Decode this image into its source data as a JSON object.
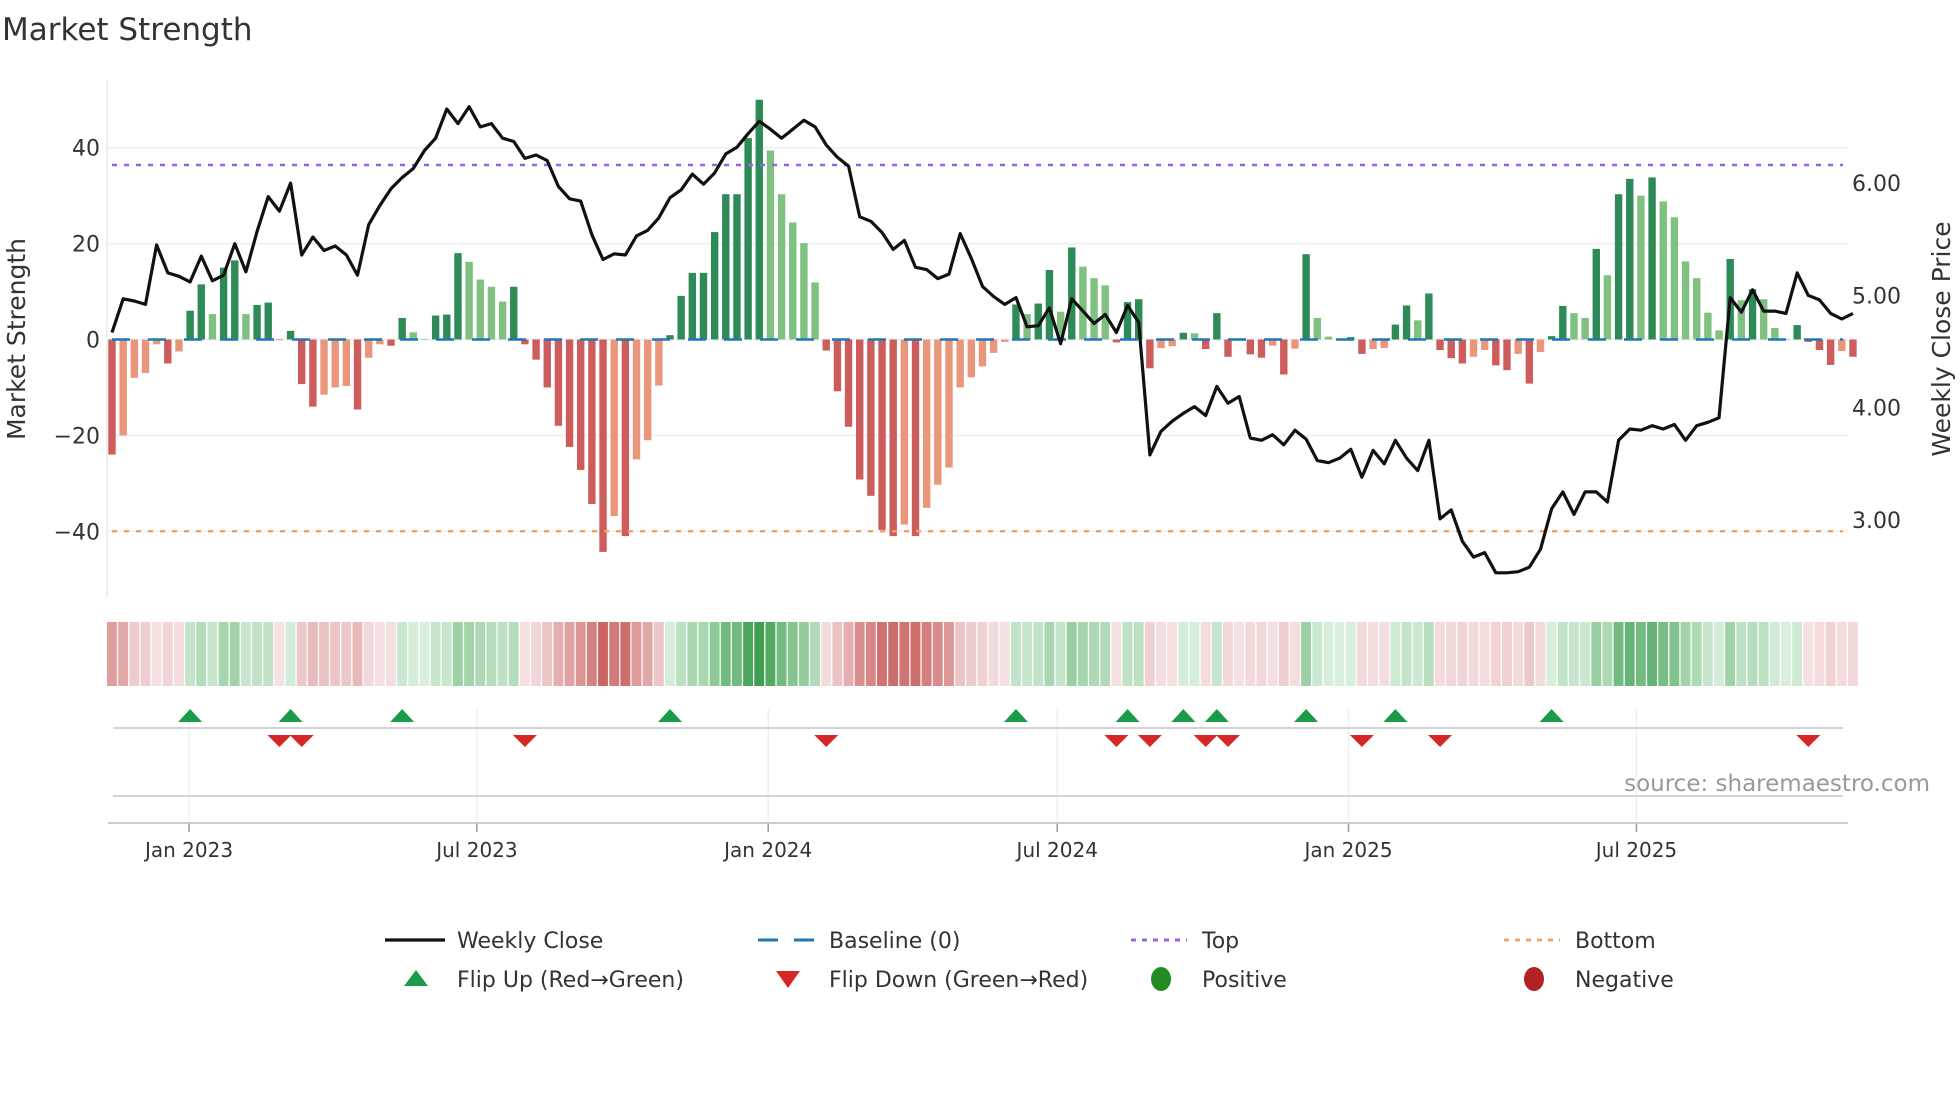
{
  "title": "Market Strength",
  "source": "source: sharemaestro.com",
  "colors": {
    "bar_up_strong": "#2e8b57",
    "bar_up_weak": "#80c080",
    "bar_down_strong": "#cd5c5c",
    "bar_down_weak": "#e9967a",
    "close_line": "#111111",
    "baseline": "#1f77b4",
    "top": "#9b63e0",
    "bottom": "#f4a460",
    "flip_up": "#1a9c46",
    "flip_down": "#d62728",
    "positive": "#228b22",
    "negative": "#b22222"
  },
  "chart_data": {
    "type": "bar",
    "title": "Market Strength",
    "x_unit": "week index (weekly observations)",
    "strength": [
      -24,
      -20,
      -8,
      -7,
      -1,
      -5,
      -2.5,
      6,
      11.5,
      5.3,
      15,
      16.5,
      5.3,
      7.2,
      7.7,
      -0.1,
      1.8,
      -9.3,
      -14,
      -11.5,
      -10,
      -9.7,
      -14.6,
      -3.8,
      -1,
      -1.3,
      4.5,
      1.5,
      0.1,
      5,
      5.2,
      18,
      16.2,
      12.5,
      11,
      7.9,
      11,
      -1,
      -4.2,
      -10,
      -18,
      -22.4,
      -27.2,
      -34.3,
      -44.3,
      -36.8,
      -41,
      -25,
      -21,
      -9.6,
      0.9,
      9.1,
      13.9,
      13.9,
      22.4,
      30.3,
      30.3,
      42,
      50,
      39.4,
      30.3,
      24.4,
      20.1,
      11.9,
      -2.3,
      -10.8,
      -18.2,
      -29.2,
      -32.6,
      -39.7,
      -41,
      -38.6,
      -41,
      -35.1,
      -30.3,
      -26.7,
      -10,
      -7.9,
      -5.6,
      -2.8,
      -0.5,
      7.3,
      5.3,
      7.5,
      14.5,
      5.8,
      19.2,
      15.2,
      12.8,
      11.3,
      -0.6,
      7.8,
      8.4,
      -6,
      -1.8,
      -1.4,
      1.4,
      1.3,
      -2,
      5.5,
      -3.6,
      -0.2,
      -3.1,
      -3.8,
      -1.3,
      -7.3,
      -1.9,
      17.8,
      4.5,
      0.6,
      0.2,
      0.5,
      -3,
      -2,
      -1.8,
      3.1,
      7.1,
      4,
      9.6,
      -2.2,
      -3.9,
      -5,
      -3.6,
      -2.2,
      -5.4,
      -6.4,
      -3,
      -9.2,
      -2.6,
      0.7,
      7,
      5.5,
      4.5,
      18.9,
      13.4,
      30.3,
      33.5,
      30,
      33.8,
      28.8,
      25.5,
      16.3,
      12.8,
      5.6,
      1.9,
      16.8,
      8.2,
      10.5,
      8.4,
      2.4,
      0.1,
      3,
      -0.5,
      -2.2,
      -5.3,
      -2.4,
      -3.6
    ],
    "weekly_close": [
      4.67,
      4.97,
      4.95,
      4.92,
      5.45,
      5.2,
      5.17,
      5.12,
      5.35,
      5.13,
      5.18,
      5.46,
      5.21,
      5.57,
      5.88,
      5.75,
      6.0,
      5.36,
      5.52,
      5.4,
      5.44,
      5.36,
      5.18,
      5.63,
      5.8,
      5.95,
      6.05,
      6.13,
      6.29,
      6.4,
      6.66,
      6.53,
      6.68,
      6.5,
      6.53,
      6.4,
      6.37,
      6.22,
      6.25,
      6.2,
      5.97,
      5.86,
      5.84,
      5.54,
      5.32,
      5.37,
      5.36,
      5.53,
      5.58,
      5.69,
      5.87,
      5.94,
      6.08,
      5.99,
      6.09,
      6.26,
      6.32,
      6.44,
      6.55,
      6.48,
      6.4,
      6.48,
      6.56,
      6.5,
      6.34,
      6.23,
      6.15,
      5.7,
      5.66,
      5.56,
      5.41,
      5.49,
      5.25,
      5.23,
      5.15,
      5.19,
      5.55,
      5.33,
      5.08,
      4.99,
      4.92,
      4.98,
      4.72,
      4.73,
      4.89,
      4.57,
      4.97,
      4.86,
      4.75,
      4.83,
      4.67,
      4.91,
      4.76,
      3.58,
      3.79,
      3.88,
      3.95,
      4.01,
      3.93,
      4.19,
      4.04,
      4.1,
      3.73,
      3.71,
      3.76,
      3.67,
      3.8,
      3.72,
      3.53,
      3.51,
      3.55,
      3.63,
      3.38,
      3.62,
      3.5,
      3.71,
      3.55,
      3.44,
      3.71,
      3.01,
      3.09,
      2.81,
      2.67,
      2.71,
      2.53,
      2.53,
      2.54,
      2.58,
      2.74,
      3.1,
      3.25,
      3.05,
      3.25,
      3.25,
      3.16,
      3.71,
      3.81,
      3.8,
      3.84,
      3.81,
      3.85,
      3.71,
      3.84,
      3.87,
      3.91,
      4.98,
      4.85,
      5.05,
      4.86,
      4.86,
      4.84,
      5.2,
      5.0,
      4.96,
      4.84,
      4.79,
      4.84
    ],
    "flip_up_weeks": [
      7,
      16,
      26,
      50,
      81,
      91,
      96,
      99,
      107,
      115,
      129
    ],
    "flip_down_weeks": [
      15,
      17,
      37,
      64,
      90,
      93,
      98,
      100,
      112,
      119,
      152
    ],
    "baseline": 0,
    "top_level": 36.4,
    "bottom_level": -40,
    "y_left": {
      "label": "Market Strength",
      "range": [
        -54,
        54
      ],
      "ticks": [
        {
          "value": 40,
          "label": "40"
        },
        {
          "value": 20,
          "label": "20"
        },
        {
          "value": 0,
          "label": "0"
        },
        {
          "value": -20,
          "label": "−20"
        },
        {
          "value": -40,
          "label": "−40"
        }
      ]
    },
    "y_right": {
      "label": "Weekly Close Price",
      "range": [
        2.31,
        6.92
      ],
      "ticks": [
        {
          "value": 6,
          "label": "6.00"
        },
        {
          "value": 5,
          "label": "5.00"
        },
        {
          "value": 4,
          "label": "4.00"
        },
        {
          "value": 3,
          "label": "3.00"
        }
      ]
    },
    "x_ticks": [
      {
        "label": "Jan 2023",
        "week": 6.9
      },
      {
        "label": "Jul 2023",
        "week": 32.7
      },
      {
        "label": "Jan 2024",
        "week": 58.8
      },
      {
        "label": "Jul 2024",
        "week": 84.7
      },
      {
        "label": "Jan 2025",
        "week": 110.8
      },
      {
        "label": "Jul 2025",
        "week": 136.6
      }
    ],
    "grid": true,
    "legend_position": "bottom",
    "legend": [
      {
        "label": "Weekly Close",
        "symbol": "solid-line"
      },
      {
        "label": "Baseline (0)",
        "symbol": "dashed-line"
      },
      {
        "label": "Top",
        "symbol": "dotted-line"
      },
      {
        "label": "Bottom",
        "symbol": "dotted-line"
      },
      {
        "label": "Flip Up (Red→Green)",
        "symbol": "triangle-up"
      },
      {
        "label": "Flip Down (Green→Red)",
        "symbol": "triangle-down"
      },
      {
        "label": "Positive",
        "symbol": "circle"
      },
      {
        "label": "Negative",
        "symbol": "circle"
      }
    ]
  }
}
